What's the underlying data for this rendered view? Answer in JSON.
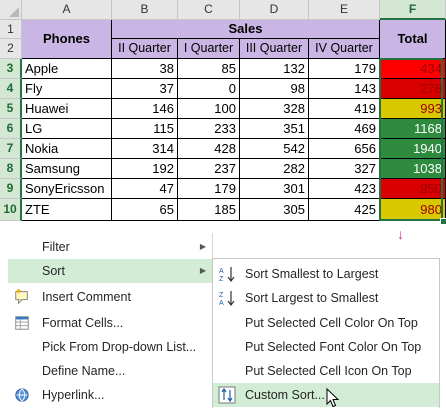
{
  "columns": [
    "A",
    "B",
    "C",
    "D",
    "E",
    "F"
  ],
  "rows": [
    "1",
    "2",
    "3",
    "4",
    "5",
    "6",
    "7",
    "8",
    "9",
    "10"
  ],
  "table": {
    "phones_header": "Phones",
    "sales_header": "Sales",
    "total_header": "Total",
    "quarters": [
      "II Quarter",
      "I Quarter",
      "III Quarter",
      "IV Quarter"
    ],
    "data": [
      {
        "name": "Apple",
        "q": [
          "38",
          "85",
          "132",
          "179"
        ],
        "total": "434",
        "color": "#ff0000"
      },
      {
        "name": "Fly",
        "q": [
          "37",
          "0",
          "98",
          "143"
        ],
        "total": "278",
        "color": "#d80000"
      },
      {
        "name": "Huawei",
        "q": [
          "146",
          "100",
          "328",
          "419"
        ],
        "total": "993",
        "color": "#d8c800"
      },
      {
        "name": "LG",
        "q": [
          "115",
          "233",
          "351",
          "469"
        ],
        "total": "1168",
        "color": "#2e8b3e"
      },
      {
        "name": "Nokia",
        "q": [
          "314",
          "428",
          "542",
          "656"
        ],
        "total": "1940",
        "color": "#2e8b3e"
      },
      {
        "name": "Samsung",
        "q": [
          "192",
          "237",
          "282",
          "327"
        ],
        "total": "1038",
        "color": "#2e8b3e"
      },
      {
        "name": "SonyEricsson",
        "q": [
          "47",
          "179",
          "301",
          "423"
        ],
        "total": "950",
        "color": "#d80000"
      },
      {
        "name": "ZTE",
        "q": [
          "65",
          "185",
          "305",
          "425"
        ],
        "total": "980",
        "color": "#d8c800"
      }
    ]
  },
  "context_menu": {
    "items": [
      {
        "label": "Filter",
        "icon": ""
      },
      {
        "label": "Sort",
        "icon": ""
      },
      {
        "label": "Insert Comment",
        "icon": "comment-icon"
      },
      {
        "label": "Format Cells...",
        "icon": "format-cells-icon"
      },
      {
        "label": "Pick From Drop-down List...",
        "icon": ""
      },
      {
        "label": "Define Name...",
        "icon": ""
      },
      {
        "label": "Hyperlink...",
        "icon": "hyperlink-icon"
      }
    ]
  },
  "sort_submenu": {
    "items": [
      {
        "label": "Sort Smallest to Largest",
        "icon": "sort-ascending-icon"
      },
      {
        "label": "Sort Largest to Smallest",
        "icon": "sort-descending-icon"
      },
      {
        "label": "Put Selected Cell Color On Top",
        "icon": ""
      },
      {
        "label": "Put Selected Font Color On Top",
        "icon": ""
      },
      {
        "label": "Put Selected Cell Icon On Top",
        "icon": ""
      },
      {
        "label": "Custom Sort...",
        "icon": "custom-sort-icon"
      }
    ]
  },
  "accent": "#217346",
  "header_fill": "#c9b6e4",
  "menu_highlight": "#d3ecd6"
}
